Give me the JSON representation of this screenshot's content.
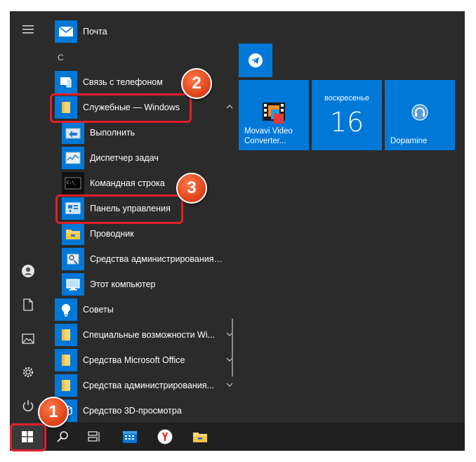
{
  "section_letter": "С",
  "apps": [
    {
      "label": "Почта",
      "icon": "mail-icon"
    },
    {
      "label": "Связь с телефоном",
      "icon": "phone-link-icon"
    },
    {
      "label": "Служебные — Windows",
      "icon": "folder-icon"
    },
    {
      "label": "Выполнить",
      "icon": "run-icon"
    },
    {
      "label": "Диспетчер задач",
      "icon": "task-manager-icon"
    },
    {
      "label": "Командная строка",
      "icon": "cmd-icon"
    },
    {
      "label": "Панель управления",
      "icon": "control-panel-icon"
    },
    {
      "label": "Проводник",
      "icon": "explorer-icon"
    },
    {
      "label": "Средства администрирования Wi...",
      "icon": "admin-tools-icon"
    },
    {
      "label": "Этот компьютер",
      "icon": "this-pc-icon"
    },
    {
      "label": "Советы",
      "icon": "tips-icon"
    },
    {
      "label": "Специальные возможности Wi...",
      "icon": "folder-icon"
    },
    {
      "label": "Средства Microsoft Office",
      "icon": "folder-icon"
    },
    {
      "label": "Средства администрирования...",
      "icon": "folder-icon"
    },
    {
      "label": "Средство 3D-просмотра",
      "icon": "3d-viewer-icon"
    }
  ],
  "tiles": {
    "telegram": {
      "icon": "telegram-icon"
    },
    "movavi": {
      "label": "Movavi Video Converter..."
    },
    "calendar": {
      "day": "воскресенье",
      "date": "16"
    },
    "dopamine": {
      "label": "Dopamine"
    }
  },
  "badges": {
    "start": "1",
    "tools": "2",
    "control_panel": "3"
  },
  "colors": {
    "accent": "#0078d7",
    "highlight": "#e0202a",
    "badge": "#e2471d"
  }
}
